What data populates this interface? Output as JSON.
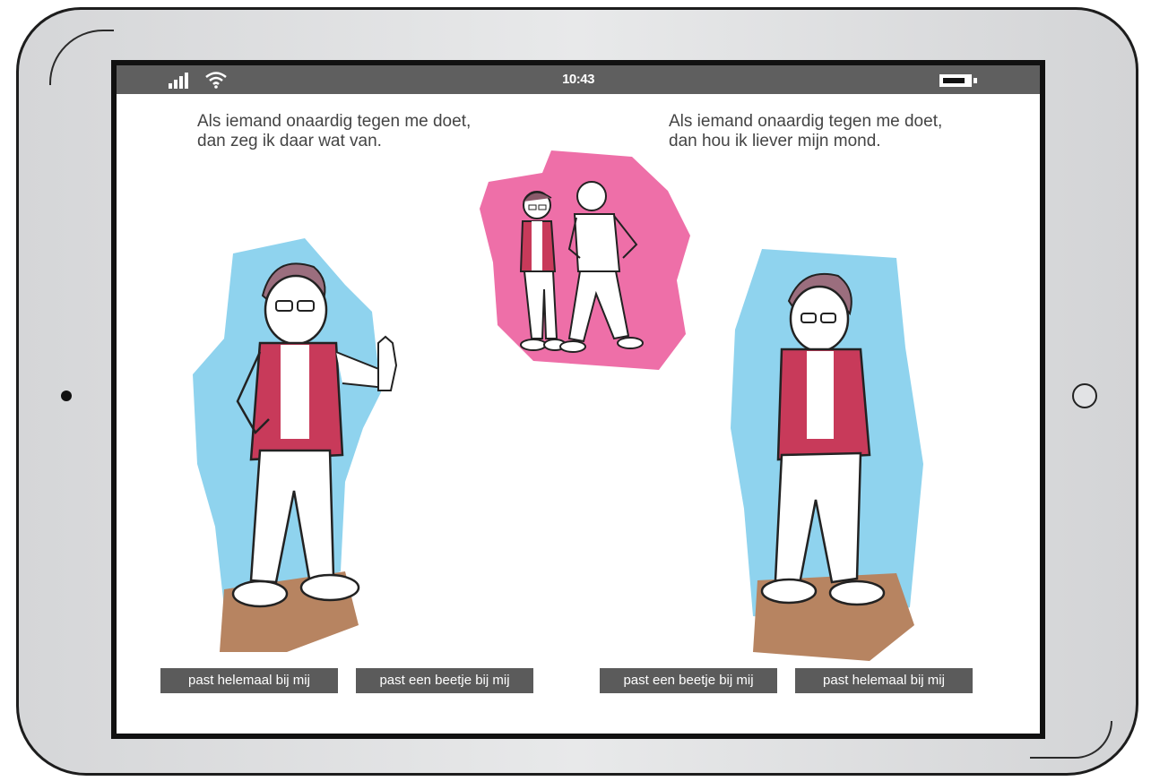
{
  "status_bar": {
    "time": "10:43"
  },
  "left_option": {
    "statement_line1": "Als iemand onaardig tegen me doet,",
    "statement_line2": "dan zeg ik daar wat van.",
    "buttons": [
      "past helemaal bij mij",
      "past een beetje bij mij"
    ]
  },
  "right_option": {
    "statement_line1": "Als iemand onaardig tegen me doet,",
    "statement_line2": "dan hou ik liever mijn mond.",
    "buttons": [
      "past een beetje bij mij",
      "past helemaal bij mij"
    ]
  },
  "colors": {
    "device_frame": "#d5d6d8",
    "status_bar": "#5f5f5f",
    "button_bg": "#5b5b5b",
    "accent_blue": "#8fd3ee",
    "accent_pink": "#ee6fa8",
    "shirt_red": "#c83a5a",
    "floor_brown": "#b78461"
  },
  "icons": [
    "signal-icon",
    "wifi-icon",
    "battery-icon",
    "camera-icon",
    "home-button-icon"
  ]
}
